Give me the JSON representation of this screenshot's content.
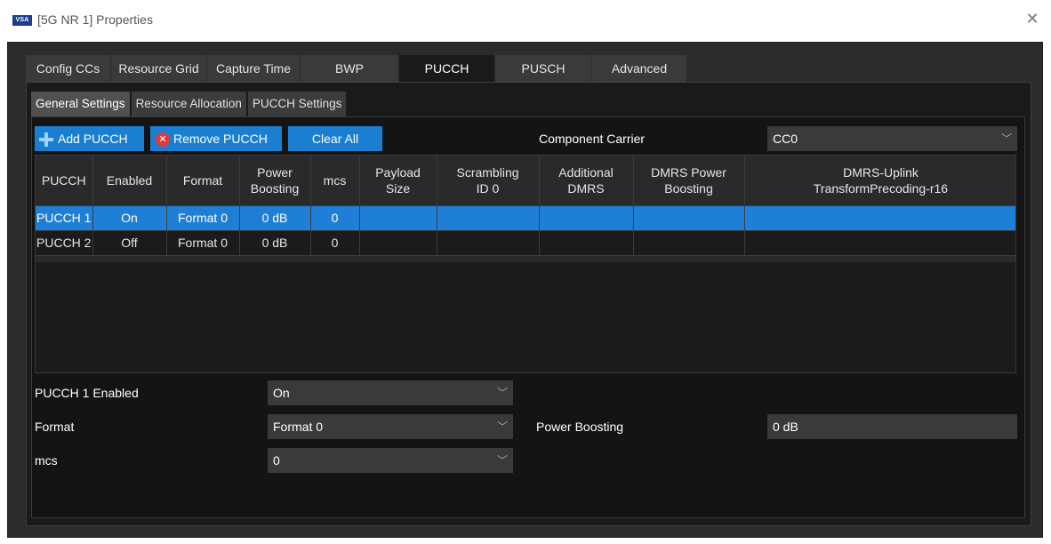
{
  "window": {
    "logo_text": "VSA",
    "title": "[5G NR 1] Properties"
  },
  "main_tabs": [
    {
      "label": "Config CCs",
      "active": false
    },
    {
      "label": "Resource Grid",
      "active": false
    },
    {
      "label": "Capture Time",
      "active": false
    },
    {
      "label": "BWP",
      "active": false
    },
    {
      "label": "PUCCH",
      "active": true
    },
    {
      "label": "PUSCH",
      "active": false
    },
    {
      "label": "Advanced",
      "active": false
    }
  ],
  "sub_tabs": [
    {
      "label": "General Settings",
      "active": true
    },
    {
      "label": "Resource Allocation",
      "active": false
    },
    {
      "label": "PUCCH Settings",
      "active": false
    }
  ],
  "toolbar": {
    "add_label": "Add PUCCH",
    "remove_label": "Remove PUCCH",
    "clear_label": "Clear All",
    "component_carrier_label": "Component Carrier",
    "component_carrier_value": "CC0"
  },
  "table": {
    "headers": [
      "PUCCH",
      "Enabled",
      "Format",
      "Power\nBoosting",
      "mcs",
      "Payload\nSize",
      "Scrambling\nID 0",
      "Additional\nDMRS",
      "DMRS Power\nBoosting",
      "DMRS-Uplink\nTransformPrecoding-r16"
    ],
    "rows": [
      [
        "PUCCH 1",
        "On",
        "Format 0",
        "0 dB",
        "0",
        "",
        "",
        "",
        "",
        ""
      ],
      [
        "PUCCH 2",
        "Off",
        "Format 0",
        "0 dB",
        "0",
        "",
        "",
        "",
        "",
        ""
      ]
    ],
    "selected_row": 0
  },
  "form": {
    "enabled_label": "PUCCH 1 Enabled",
    "enabled_value": "On",
    "format_label": "Format",
    "format_value": "Format 0",
    "power_boosting_label": "Power Boosting",
    "power_boosting_value": "0 dB",
    "mcs_label": "mcs",
    "mcs_value": "0"
  },
  "colors": {
    "accent": "#1f7fd6",
    "background": "#1a1a1a"
  }
}
